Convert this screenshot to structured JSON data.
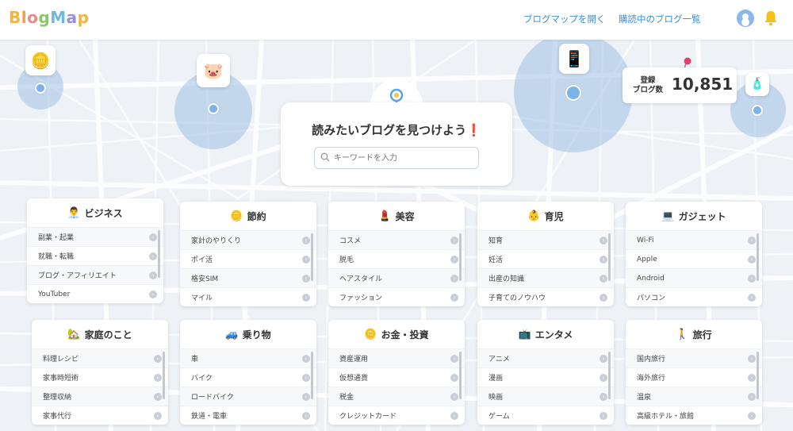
{
  "header": {
    "logo_text": "BlogMap",
    "nav": [
      "ブログマップを開く",
      "購読中のブログ一覧"
    ]
  },
  "search": {
    "title": "読みたいブログを見つけよう",
    "title_mark": "❗",
    "placeholder": "キーワードを入力"
  },
  "stats": {
    "label": "登録\nブログ数",
    "value": "10,851"
  },
  "categories": [
    {
      "title": "ビジネス",
      "icon": "👨‍💼",
      "items": [
        "副業・起業",
        "就職・転職",
        "ブログ・アフィリエイト",
        "YouTuber"
      ]
    },
    {
      "title": "節約",
      "icon": "🪙",
      "items": [
        "家計のやりくり",
        "ポイ活",
        "格安SIM",
        "マイル"
      ]
    },
    {
      "title": "美容",
      "icon": "💄",
      "items": [
        "コスメ",
        "脱毛",
        "ヘアスタイル",
        "ファッション"
      ]
    },
    {
      "title": "育児",
      "icon": "👶",
      "items": [
        "知育",
        "妊活",
        "出産の知識",
        "子育てのノウハウ"
      ]
    },
    {
      "title": "ガジェット",
      "icon": "💻",
      "items": [
        "Wi-Fi",
        "Apple",
        "Android",
        "パソコン"
      ]
    },
    {
      "title": "家庭のこと",
      "icon": "🏡",
      "items": [
        "料理レシピ",
        "家事時短術",
        "整理収納",
        "家事代行"
      ]
    },
    {
      "title": "乗り物",
      "icon": "🚙",
      "items": [
        "車",
        "バイク",
        "ロードバイク",
        "鉄道・電車"
      ]
    },
    {
      "title": "お金・投資",
      "icon": "🪙",
      "items": [
        "資産運用",
        "仮想通貨",
        "税金",
        "クレジットカード"
      ]
    },
    {
      "title": "エンタメ",
      "icon": "📺",
      "items": [
        "アニメ",
        "漫画",
        "映画",
        "ゲーム"
      ]
    },
    {
      "title": "旅行",
      "icon": "🚶",
      "items": [
        "国内旅行",
        "海外旅行",
        "温泉",
        "高級ホテル・旅館"
      ]
    }
  ],
  "colors": {
    "accent": "#3d8fd6",
    "bubble": "#8cb4e1",
    "map_bg": "#eef2f6"
  }
}
